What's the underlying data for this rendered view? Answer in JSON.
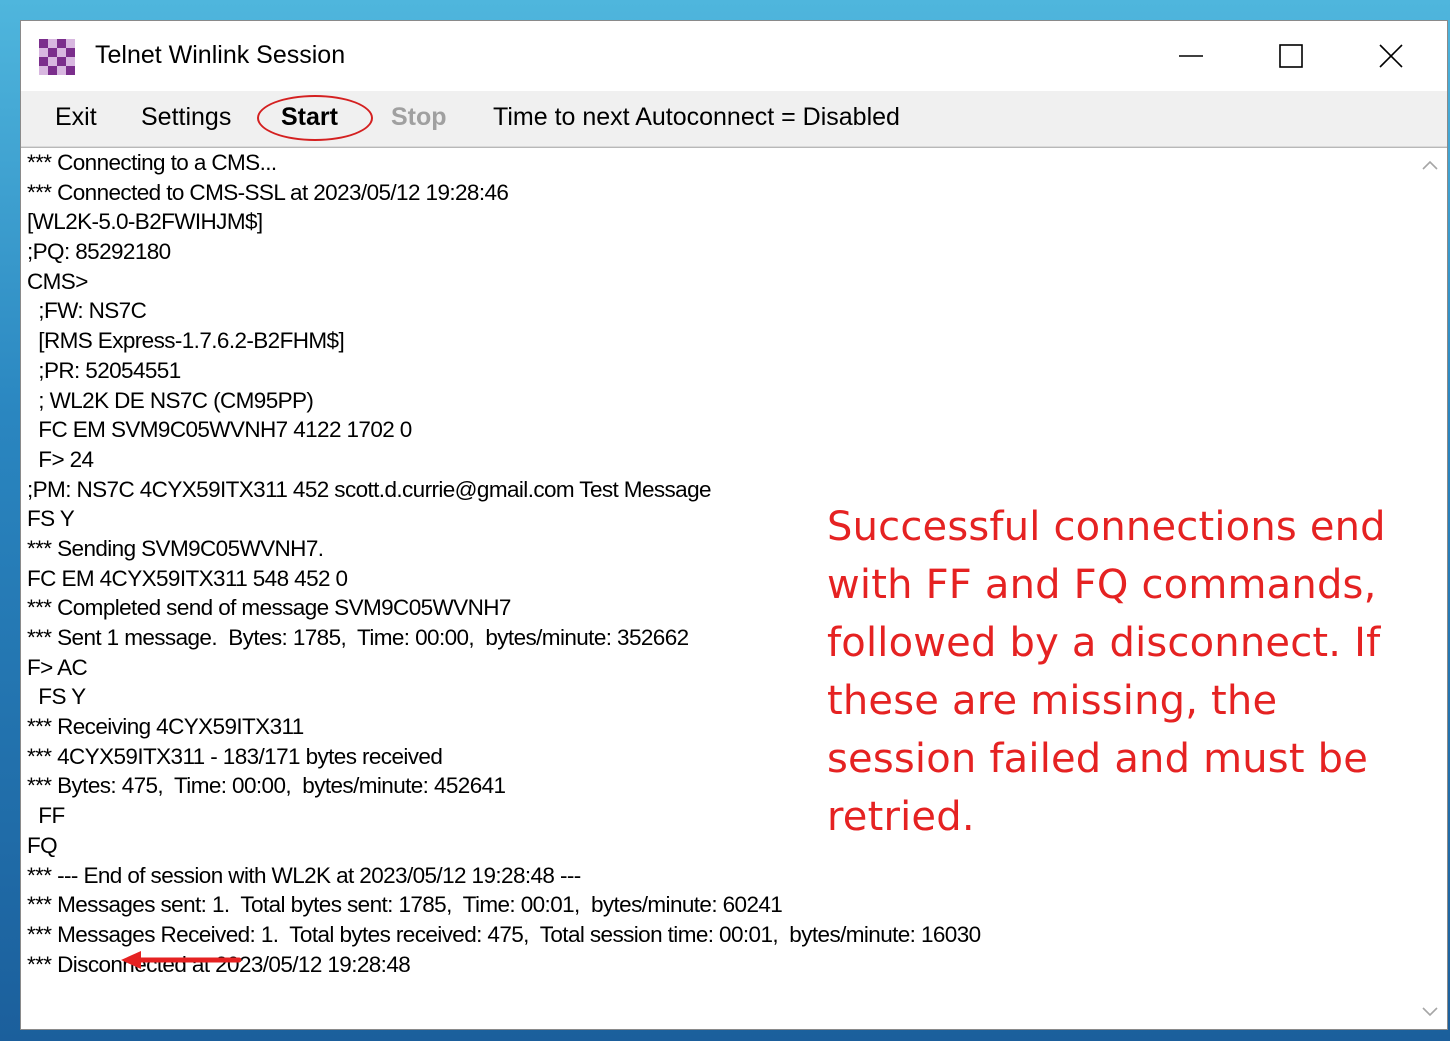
{
  "window": {
    "title": "Telnet Winlink Session",
    "controls": {
      "minimize": "minimize-icon",
      "maximize": "maximize-icon",
      "close": "close-icon"
    }
  },
  "menu": {
    "exit": "Exit",
    "settings": "Settings",
    "start": "Start",
    "stop": "Stop",
    "status": "Time to next Autoconnect = Disabled"
  },
  "log_lines": [
    "*** Connecting to a CMS...",
    "*** Connected to CMS-SSL at 2023/05/12 19:28:46",
    "[WL2K-5.0-B2FWIHJM$]",
    ";PQ: 85292180",
    "CMS>",
    "  ;FW: NS7C",
    "  [RMS Express-1.7.6.2-B2FHM$]",
    "  ;PR: 52054551",
    "  ; WL2K DE NS7C (CM95PP)",
    "  FC EM SVM9C05WVNH7 4122 1702 0",
    "  F> 24",
    ";PM: NS7C 4CYX59ITX311 452 scott.d.currie@gmail.com Test Message",
    "FS Y",
    "*** Sending SVM9C05WVNH7.",
    "FC EM 4CYX59ITX311 548 452 0",
    "*** Completed send of message SVM9C05WVNH7",
    "*** Sent 1 message.  Bytes: 1785,  Time: 00:00,  bytes/minute: 352662",
    "F> AC",
    "  FS Y",
    "*** Receiving 4CYX59ITX311",
    "*** 4CYX59ITX311 - 183/171 bytes received",
    "*** Bytes: 475,  Time: 00:00,  bytes/minute: 452641",
    "  FF",
    "FQ",
    "*** --- End of session with WL2K at 2023/05/12 19:28:48 ---",
    "*** Messages sent: 1.  Total bytes sent: 1785,  Time: 00:01,  bytes/minute: 60241",
    "*** Messages Received: 1.  Total bytes received: 475,  Total session time: 00:01,  bytes/minute: 16030",
    "*** Disconnected at 2023/05/12 19:28:48"
  ],
  "annotation": {
    "text": "Successful connections end with FF and FQ commands, followed by a disconnect. If these are missing, the session failed and must be retried.",
    "color": "#e52222"
  },
  "colors": {
    "accent_red": "#e52222",
    "disabled": "#a0a0a0"
  }
}
